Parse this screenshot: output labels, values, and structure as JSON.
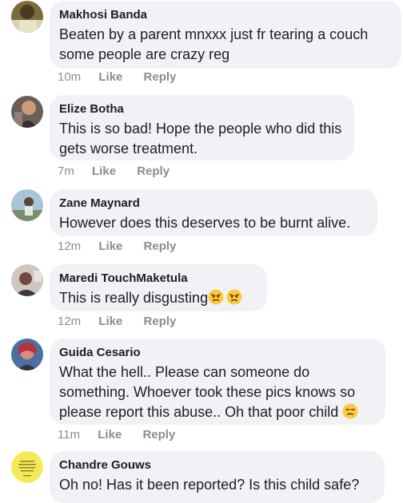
{
  "comments": [
    {
      "author": "Makhosi Banda",
      "text": "Beaten by a parent mnxxx just fr tearing a couch some people are crazy reg",
      "time": "10m",
      "like": "Like",
      "reply": "Reply",
      "avatar_icon": "profile-photo"
    },
    {
      "author": "Elize Botha",
      "text": "This is so bad! Hope the people who did this gets worse treatment.",
      "time": "7m",
      "like": "Like",
      "reply": "Reply",
      "avatar_icon": "profile-photo"
    },
    {
      "author": "Zane Maynard",
      "text": "However does this deserves to be burnt alive.",
      "time": "12m",
      "like": "Like",
      "reply": "Reply",
      "avatar_icon": "profile-photo"
    },
    {
      "author": "Maredi TouchMaketula",
      "text": "This is really disgusting",
      "time": "12m",
      "like": "Like",
      "reply": "Reply",
      "avatar_icon": "profile-photo",
      "emojis": [
        "angry-face-emoji",
        "angry-face-emoji"
      ]
    },
    {
      "author": "Guida Cesario",
      "text": "What the hell.. Please can someone do something. Whoever took these pics knows so please report this abuse.. Oh that poor child",
      "time": "11m",
      "like": "Like",
      "reply": "Reply",
      "avatar_icon": "profile-photo",
      "emojis": [
        "unamused-face-emoji"
      ]
    },
    {
      "author": "Chandre Gouws",
      "text": "Oh no! Has it been reported? Is this child safe?",
      "avatar_icon": "profile-photo"
    }
  ],
  "colors": {
    "bubble": "#f0f2f5",
    "meta": "#8a8d91",
    "text": "#1c1e21",
    "emoji": "#ffc83d"
  }
}
